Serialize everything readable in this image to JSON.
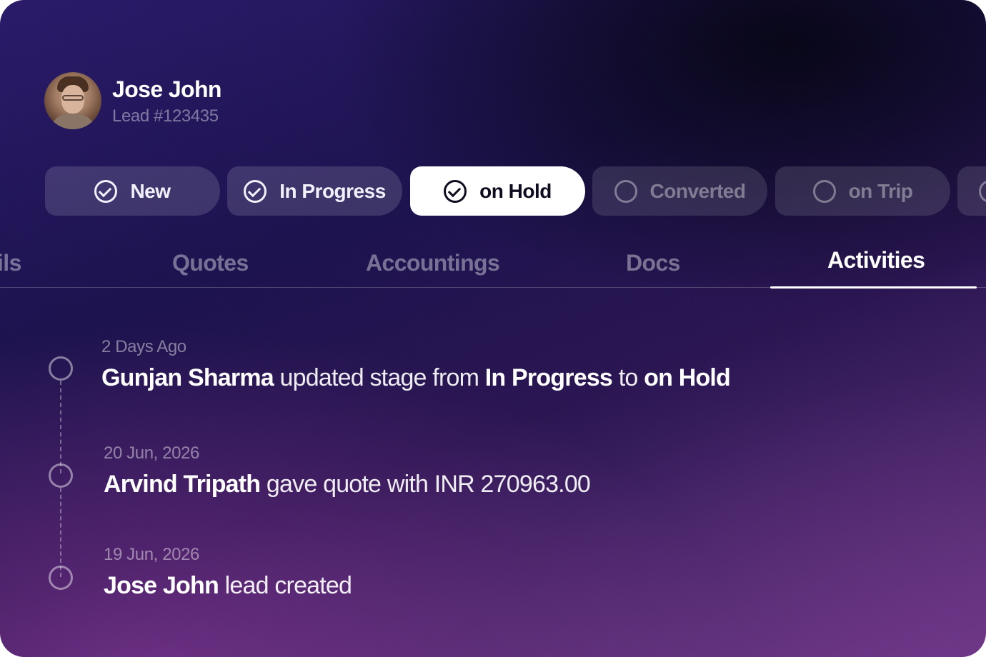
{
  "profile": {
    "name": "Jose John",
    "lead_id": "Lead #123435"
  },
  "stages": [
    {
      "label": "New",
      "state": "done",
      "icon": "check-circle-icon"
    },
    {
      "label": "In Progress",
      "state": "done",
      "icon": "check-circle-icon"
    },
    {
      "label": "on Hold",
      "state": "active",
      "icon": "check-circle-icon"
    },
    {
      "label": "Converted",
      "state": "pending",
      "icon": "circle-icon"
    },
    {
      "label": "on Trip",
      "state": "pending",
      "icon": "circle-icon"
    }
  ],
  "tabs": {
    "details_partial": "ils",
    "quotes": "Quotes",
    "accountings": "Accountings",
    "docs": "Docs",
    "activities": "Activities",
    "active": "Activities"
  },
  "activities": [
    {
      "when": "2 Days Ago",
      "actor": "Gunjan Sharma",
      "text1": " updated stage from ",
      "from": "In Progress",
      "text2": " to ",
      "to": "on Hold"
    },
    {
      "when": "20 Jun, 2026",
      "actor": "Arvind Tripath",
      "text1": " gave quote with INR 270963.00"
    },
    {
      "when": "19 Jun, 2026",
      "actor": "Jose John",
      "text1": " lead created"
    }
  ],
  "colors": {
    "active_pill_bg": "#ffffff",
    "bg_top": "#1c124e",
    "bg_bottom": "#6a3a86"
  }
}
